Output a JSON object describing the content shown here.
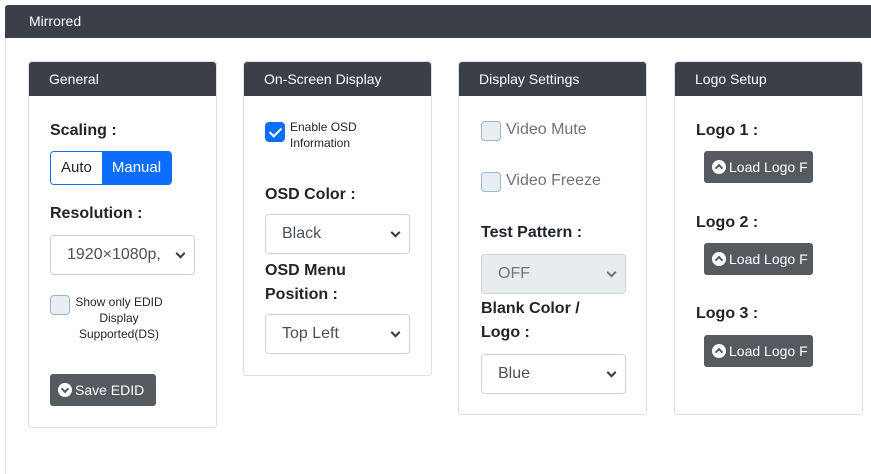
{
  "header": {
    "title": "Mirrored"
  },
  "general": {
    "title": "General",
    "scaling_label": "Scaling :",
    "scaling_options": [
      "Auto",
      "Manual"
    ],
    "scaling_selected": "Manual",
    "resolution_label": "Resolution :",
    "resolution_value": "1920×1080p,",
    "edid_checkbox_label": "Show only EDID Display Supported(DS)",
    "edid_checked": false,
    "save_edid_label": "Save EDID"
  },
  "osd": {
    "title": "On-Screen Display",
    "enable_label": "Enable OSD Information",
    "enable_checked": true,
    "color_label": "OSD Color :",
    "color_value": "Black",
    "menu_position_label": "OSD Menu Position :",
    "menu_position_value": "Top Left"
  },
  "display_settings": {
    "title": "Display Settings",
    "video_mute_label": "Video Mute",
    "video_freeze_label": "Video Freeze",
    "test_pattern_label": "Test Pattern :",
    "test_pattern_value": "OFF",
    "blank_color_label": "Blank Color / Logo :",
    "blank_color_value": "Blue"
  },
  "logo_setup": {
    "title": "Logo Setup",
    "logos": [
      {
        "label": "Logo 1 :",
        "button": "Load Logo F"
      },
      {
        "label": "Logo 2 :",
        "button": "Load Logo F"
      },
      {
        "label": "Logo 3 :",
        "button": "Load Logo F"
      }
    ]
  },
  "colors": {
    "header_bg": "#3a3f48",
    "primary": "#0d6efd",
    "dark_button": "#555a60"
  }
}
